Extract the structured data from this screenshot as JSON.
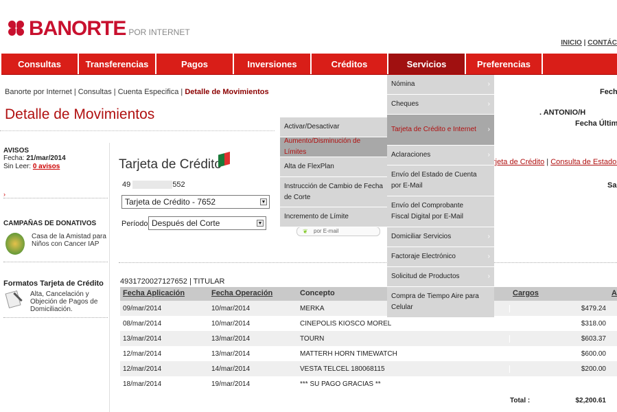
{
  "brand": {
    "name": "BANORTE",
    "sub": "POR INTERNET"
  },
  "top_links": {
    "inicio": "INICIO",
    "sep": "|",
    "contacto": "CONTÁC"
  },
  "nav": {
    "items": [
      {
        "label": "Consultas",
        "w": 113
      },
      {
        "label": "Transferencias",
        "w": 113
      },
      {
        "label": "Pagos",
        "w": 113
      },
      {
        "label": "Inversiones",
        "w": 113
      },
      {
        "label": "Créditos",
        "w": 112
      },
      {
        "label": "Servicios",
        "w": 113
      },
      {
        "label": "Preferencias",
        "w": 112
      }
    ],
    "active_index": 5
  },
  "breadcrumb": {
    "path": "Banorte por Internet | Consultas | Cuenta Especifica | ",
    "current": "Detalle de Movimientos"
  },
  "header_right": {
    "fecha": "Fecha",
    "user": ". ANTONIO/H",
    "fecha_ultimo": "Fecha Último A"
  },
  "page_title": "Detalle de Movimientos",
  "sidebar": {
    "avisos": {
      "title": "AVISOS",
      "fecha_label": "Fecha: ",
      "fecha": "21/mar/2014",
      "sin_leer_label": "Sin Leer: ",
      "sin_leer": "0 avisos"
    },
    "arrow": "›",
    "campanas": {
      "title": "CAMPAÑAS DE DONATIVOS",
      "item": "Casa de la Amistad para Niños con Cancer IAP"
    },
    "formatos": {
      "title": "Formatos Tarjeta de Crédito",
      "item": "Alta, Cancelación y Objeción de Pagos de Domiciliación."
    }
  },
  "card": {
    "title": "Tarjeta de Crédito",
    "number_start": "49",
    "number_end": "552",
    "account_select": "Tarjeta de Crédito - 7652",
    "periodo_label": "Período:",
    "periodo_select": "Después del Corte",
    "account_line": "4931720027127652 | TITULAR"
  },
  "links_right": {
    "link1": "rjeta de Crédito",
    "sep": " | ",
    "link2": "Consulta de Estados d",
    "saldo": "Sal"
  },
  "email_tag": "por E-mail",
  "flag_colors": [
    "#ffffff",
    "#e03030",
    "#ffffff"
  ],
  "table": {
    "headers": [
      "Fecha Aplicación",
      "Fecha Operación",
      "Concepto",
      "Cargos",
      "Ab"
    ],
    "rows": [
      [
        "09/mar/2014",
        "10/mar/2014",
        "MERKA",
        "$479.24"
      ],
      [
        "08/mar/2014",
        "10/mar/2014",
        "CINEPOLIS KIOSCO MOREL",
        "$318.00"
      ],
      [
        "13/mar/2014",
        "13/mar/2014",
        "TOURN",
        "$603.37"
      ],
      [
        "12/mar/2014",
        "13/mar/2014",
        "MATTERH HORN TIMEWATCH",
        "$600.00"
      ],
      [
        "12/mar/2014",
        "14/mar/2014",
        "VESTA TELCEL 180068115",
        "$200.00"
      ],
      [
        "18/mar/2014",
        "19/mar/2014",
        "*** SU PAGO GRACIAS **",
        ""
      ]
    ],
    "total_label": "Total :",
    "total_value": "$2,200.61"
  },
  "servicios_menu": [
    {
      "label": "Nómina",
      "arrow": true
    },
    {
      "label": "Cheques",
      "arrow": true
    },
    {
      "label": "Tarjeta de Crédito e Internet",
      "arrow": true,
      "highlight": true
    },
    {
      "label": "Aclaraciones",
      "arrow": true
    },
    {
      "label": "Envío del Estado de Cuenta por E-Mail",
      "arrow": false
    },
    {
      "label": "Envío del Comprobante Fiscal Digital por E-Mail",
      "arrow": false
    },
    {
      "label": "Domiciliar Servicios",
      "arrow": true
    },
    {
      "label": "Factoraje Electrónico",
      "arrow": true
    },
    {
      "label": "Solicitud de Productos",
      "arrow": true
    },
    {
      "label": "Compra de Tiempo Aire para Celular",
      "arrow": false
    }
  ],
  "tarjeta_submenu": [
    {
      "label": "Activar/Desactivar"
    },
    {
      "label": "Aumento/Disminución de Límites",
      "highlight": true
    },
    {
      "label": "Alta de FlexPlan"
    },
    {
      "label": "Instrucción de Cambio de Fecha de Corte"
    },
    {
      "label": "Incremento de Límite"
    }
  ],
  "icons": {
    "chevron": "›",
    "select_arrow": "▼"
  }
}
